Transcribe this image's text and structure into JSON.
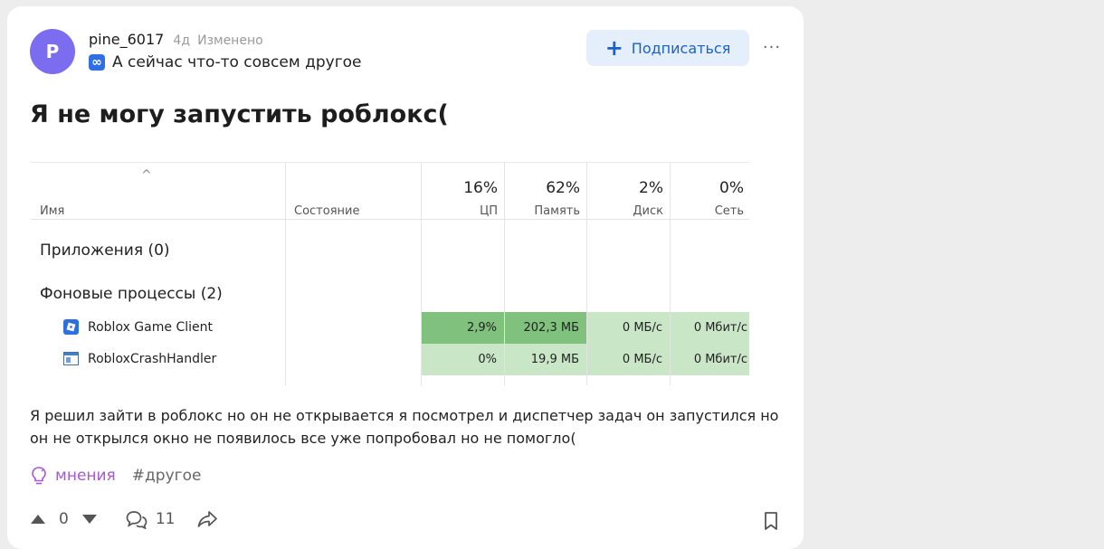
{
  "post": {
    "author": {
      "initial": "P",
      "name": "pine_6017",
      "age": "4д",
      "edited": "Изменено"
    },
    "community": {
      "icon": "infinity-icon",
      "name": "А сейчас что-то совсем другое"
    },
    "subscribe_label": "Подписаться",
    "more_label": "···",
    "title": "Я не могу запустить роблокс(",
    "body": "Я решил зайти в роблокс но он не открывается я посмотрел и диспетчер задач он запустился но он не открылся окно не появилось все уже попробовал но не помогло(",
    "tags": {
      "topic": "мнения",
      "hashtag": "#другое"
    },
    "footer": {
      "score": "0",
      "comments": "11"
    }
  },
  "task_manager": {
    "sort_arrow": "^",
    "columns": {
      "name": "Имя",
      "status": "Состояние",
      "cpu": {
        "pct": "16%",
        "label": "ЦП"
      },
      "mem": {
        "pct": "62%",
        "label": "Память"
      },
      "disk": {
        "pct": "2%",
        "label": "Диск"
      },
      "net": {
        "pct": "0%",
        "label": "Сеть"
      }
    },
    "groups": {
      "apps": "Приложения (0)",
      "background": "Фоновые процессы (2)"
    },
    "rows": [
      {
        "name": "Roblox Game Client",
        "cpu": "2,9%",
        "mem": "202,3 МБ",
        "disk": "0 МБ/с",
        "net": "0 Мбит/с"
      },
      {
        "name": "RobloxCrashHandler",
        "cpu": "0%",
        "mem": "19,9 МБ",
        "disk": "0 МБ/с",
        "net": "0 Мбит/с"
      }
    ],
    "colors": {
      "heat_high": "#7fc17d",
      "heat_low": "#c9e7c6"
    }
  }
}
